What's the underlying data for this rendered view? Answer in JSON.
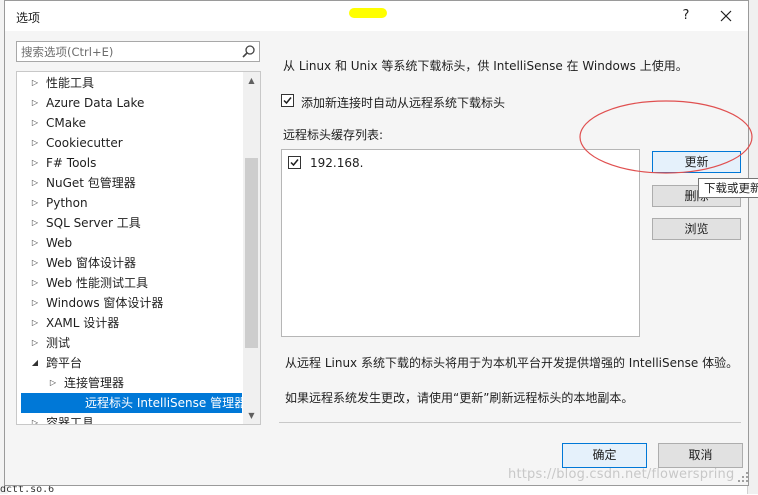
{
  "dialog": {
    "title": "选项",
    "help_label": "?"
  },
  "search": {
    "placeholder": "搜索选项(Ctrl+E)"
  },
  "tree": {
    "items": [
      {
        "label": "性能工具",
        "expanded": false
      },
      {
        "label": "Azure Data Lake",
        "expanded": false
      },
      {
        "label": "CMake",
        "expanded": false
      },
      {
        "label": "Cookiecutter",
        "expanded": false
      },
      {
        "label": "F# Tools",
        "expanded": false
      },
      {
        "label": "NuGet 包管理器",
        "expanded": false
      },
      {
        "label": "Python",
        "expanded": false
      },
      {
        "label": "SQL Server 工具",
        "expanded": false
      },
      {
        "label": "Web",
        "expanded": false
      },
      {
        "label": "Web 窗体设计器",
        "expanded": false
      },
      {
        "label": "Web 性能测试工具",
        "expanded": false
      },
      {
        "label": "Windows 窗体设计器",
        "expanded": false
      },
      {
        "label": "XAML 设计器",
        "expanded": false
      },
      {
        "label": "测试",
        "expanded": false
      },
      {
        "label": "跨平台",
        "expanded": true
      },
      {
        "label": "连接管理器",
        "expanded": false
      },
      {
        "label": "远程标头 IntelliSense 管理器",
        "selected": true
      },
      {
        "label": "容器工具",
        "expanded": false
      }
    ]
  },
  "panel": {
    "description": "从 Linux 和 Unix 等系统下载标头，供 IntelliSense 在 Windows 上使用。",
    "auto_download_label": "添加新连接时自动从远程系统下载标头",
    "auto_download_checked": true,
    "cache_list_label": "远程标头缓存列表:",
    "cache_items": [
      {
        "label": "192.168.",
        "checked": true
      }
    ],
    "update_button": "更新",
    "delete_button": "删除",
    "browse_button": "浏览",
    "tooltip": "下载或更新",
    "info_text": "从远程 Linux 系统下载的标头将用于为本机平台开发提供增强的 IntelliSense 体验。",
    "hint_text": "如果远程系统发生更改，请使用“更新”刷新远程标头的本地副本。"
  },
  "footer": {
    "ok_button": "确定",
    "cancel_button": "取消"
  },
  "watermark": "https://blog.csdn.net/flowerspring",
  "background": {
    "fragment": "dctt.so.6"
  },
  "colors": {
    "selection": "#0078d7",
    "annotation": "#e05050",
    "highlight": "#ffff00"
  }
}
